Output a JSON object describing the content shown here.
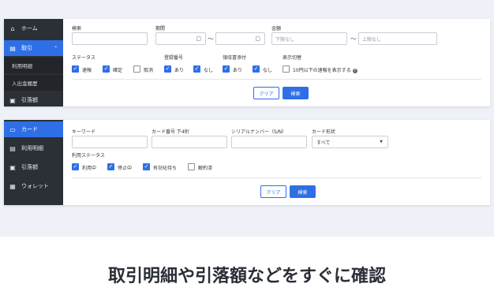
{
  "colors": {
    "accent": "#2f6fe6",
    "sidebar": "#2b2f36",
    "background": "#eef1f8"
  },
  "panel1": {
    "sidebar": {
      "home": {
        "icon": "home-icon",
        "label": "ホーム"
      },
      "transactions": {
        "icon": "document-icon",
        "label": "取引"
      },
      "sub_usage": "利用明細",
      "sub_deposit": "入出金履歴",
      "withdrawal": {
        "icon": "money-icon",
        "label": "引落額"
      }
    },
    "labels": {
      "search": "検索",
      "period": "期間",
      "amount": "金額",
      "status": "ステータス",
      "registration": "登録番号",
      "receipt": "領収書添付",
      "display": "表示切替"
    },
    "amount_min_placeholder": "下限なし",
    "amount_max_placeholder": "上限なし",
    "tilde": "〜",
    "status": [
      {
        "label": "速報",
        "checked": true
      },
      {
        "label": "確定",
        "checked": true
      },
      {
        "label": "取消",
        "checked": false
      }
    ],
    "registration": [
      {
        "label": "あり",
        "checked": true
      },
      {
        "label": "なし",
        "checked": true
      }
    ],
    "receipt": [
      {
        "label": "あり",
        "checked": true
      },
      {
        "label": "なし",
        "checked": true
      }
    ],
    "display_option": {
      "label": "10円以下の速報を表示する",
      "checked": false
    },
    "clear_label": "クリア",
    "search_label": "検索"
  },
  "panel2": {
    "sidebar": {
      "card": {
        "icon": "card-icon",
        "label": "カード"
      },
      "usage": {
        "icon": "document-icon",
        "label": "利用明細"
      },
      "withdrawal": {
        "icon": "money-icon",
        "label": "引落額"
      },
      "wallet": {
        "icon": "wallet-icon",
        "label": "ウォレット"
      }
    },
    "labels": {
      "keyword": "キーワード",
      "card_last4": "カード番号 下4桁",
      "serial": "シリアルナンバー（S/N）",
      "card_type": "カード形状",
      "usage_status": "利用ステータス"
    },
    "card_type_selected": "すべて",
    "statuses": [
      {
        "label": "利用中",
        "checked": true
      },
      {
        "label": "停止中",
        "checked": true
      },
      {
        "label": "有効化待ち",
        "checked": true
      },
      {
        "label": "解約済",
        "checked": false
      }
    ],
    "clear_label": "クリア",
    "search_label": "検索"
  },
  "caption": "取引明細や引落額などをすぐに確認"
}
